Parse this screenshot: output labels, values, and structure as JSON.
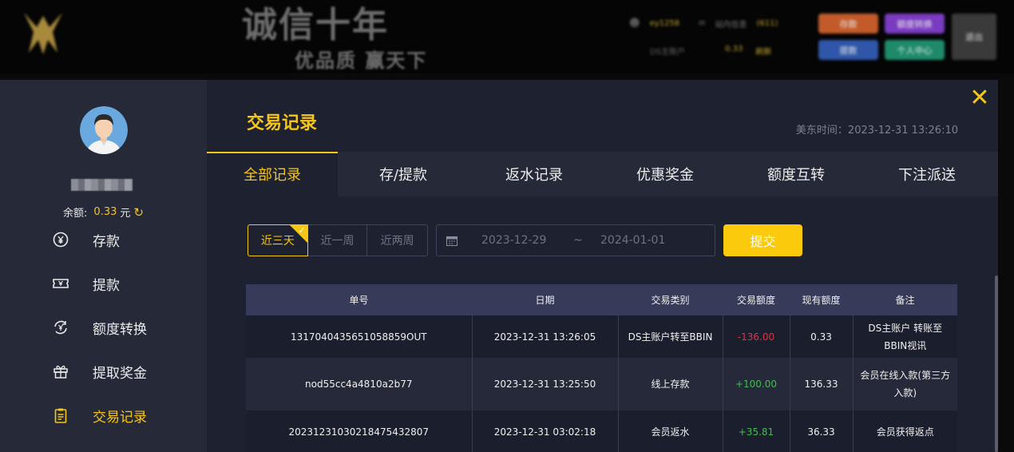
{
  "header": {
    "slogan_main": "诚信十年",
    "slogan_sub": "优品质 赢天下",
    "username": "ey1258",
    "messages_label": "站内信息",
    "messages_count": "(611)",
    "ds_account_label": "DS主账户",
    "ds_account_amount": "0.33",
    "ds_account_action": "刷新",
    "btn_deposit": "存款",
    "btn_transfer": "额度转换",
    "btn_withdraw": "提款",
    "btn_personal": "个人中心",
    "btn_logout": "退出"
  },
  "sidebar": {
    "balance_label": "余额:",
    "balance_amount": "0.33",
    "balance_unit": "元",
    "items": [
      {
        "label": "存款",
        "icon": "yen-circle-icon"
      },
      {
        "label": "提款",
        "icon": "ticket-icon"
      },
      {
        "label": "额度转换",
        "icon": "transfer-yen-icon"
      },
      {
        "label": "提取奖金",
        "icon": "gift-icon"
      },
      {
        "label": "交易记录",
        "icon": "clipboard-icon",
        "active": true
      }
    ]
  },
  "main": {
    "title": "交易记录",
    "et_time_label": "美东时间：",
    "et_time_value": "2023-12-31 13:26:10",
    "close": "✕",
    "tabs": [
      "全部记录",
      "存/提款",
      "返水记录",
      "优惠奖金",
      "额度互转",
      "下注派送"
    ],
    "active_tab": 0,
    "ranges": [
      "近三天",
      "近一周",
      "近两周"
    ],
    "active_range": 0,
    "range_check": "✓",
    "date_start": "2023-12-29",
    "date_sep": "~",
    "date_end": "2024-01-01",
    "submit": "提交",
    "columns": [
      "单号",
      "日期",
      "交易类别",
      "交易额度",
      "现有额度",
      "备注"
    ],
    "rows": [
      {
        "id": "1317040435651058859OUT",
        "date": "2023-12-31 13:26:05",
        "type": "DS主账户转至BBIN",
        "amount": "-136.00",
        "sign": "neg",
        "balance": "0.33",
        "note": "DS主账户 转账至 BBIN视讯"
      },
      {
        "id": "nod55cc4a4810a2b77",
        "date": "2023-12-31 13:25:50",
        "type": "线上存款",
        "amount": "+100.00",
        "sign": "pos",
        "balance": "136.33",
        "note": "会员在线入款(第三方入款)"
      },
      {
        "id": "20231231030218475432807",
        "date": "2023-12-31 03:02:18",
        "type": "会员返水",
        "amount": "+35.81",
        "sign": "pos",
        "balance": "36.33",
        "note": "会员获得返点"
      }
    ]
  },
  "colors": {
    "accent": "#f5c518",
    "negative": "#e0334a",
    "positive": "#3fbf4a",
    "modal_bg": "#1e2130",
    "sidebar_bg": "#262938"
  }
}
